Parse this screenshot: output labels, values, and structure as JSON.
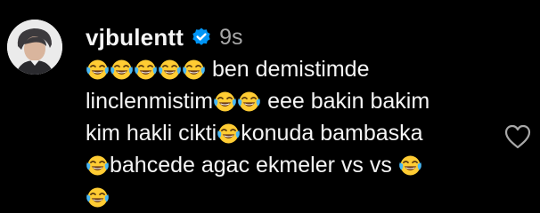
{
  "comment": {
    "username": "vjbulentt",
    "verified": true,
    "timestamp": "9s",
    "lines": {
      "l1_text": "ben demistimde",
      "l2_text": "linclenmistim",
      "l2_tail": "eee bakin bakim",
      "l3_head": "kim hakli cikti",
      "l3_tail": "konuda bambaska",
      "l4_text": "bahcede agac ekmeler vs vs"
    },
    "emoji": "face-with-tears-of-joy-emoji",
    "like_icon": "heart-outline-icon",
    "verified_icon": "verified-badge-icon"
  },
  "colors": {
    "background": "#000000",
    "text": "#f5f5f5",
    "muted": "#a8a8a8",
    "verified_blue": "#0095f6",
    "emoji_yellow": "#ffcc33"
  }
}
